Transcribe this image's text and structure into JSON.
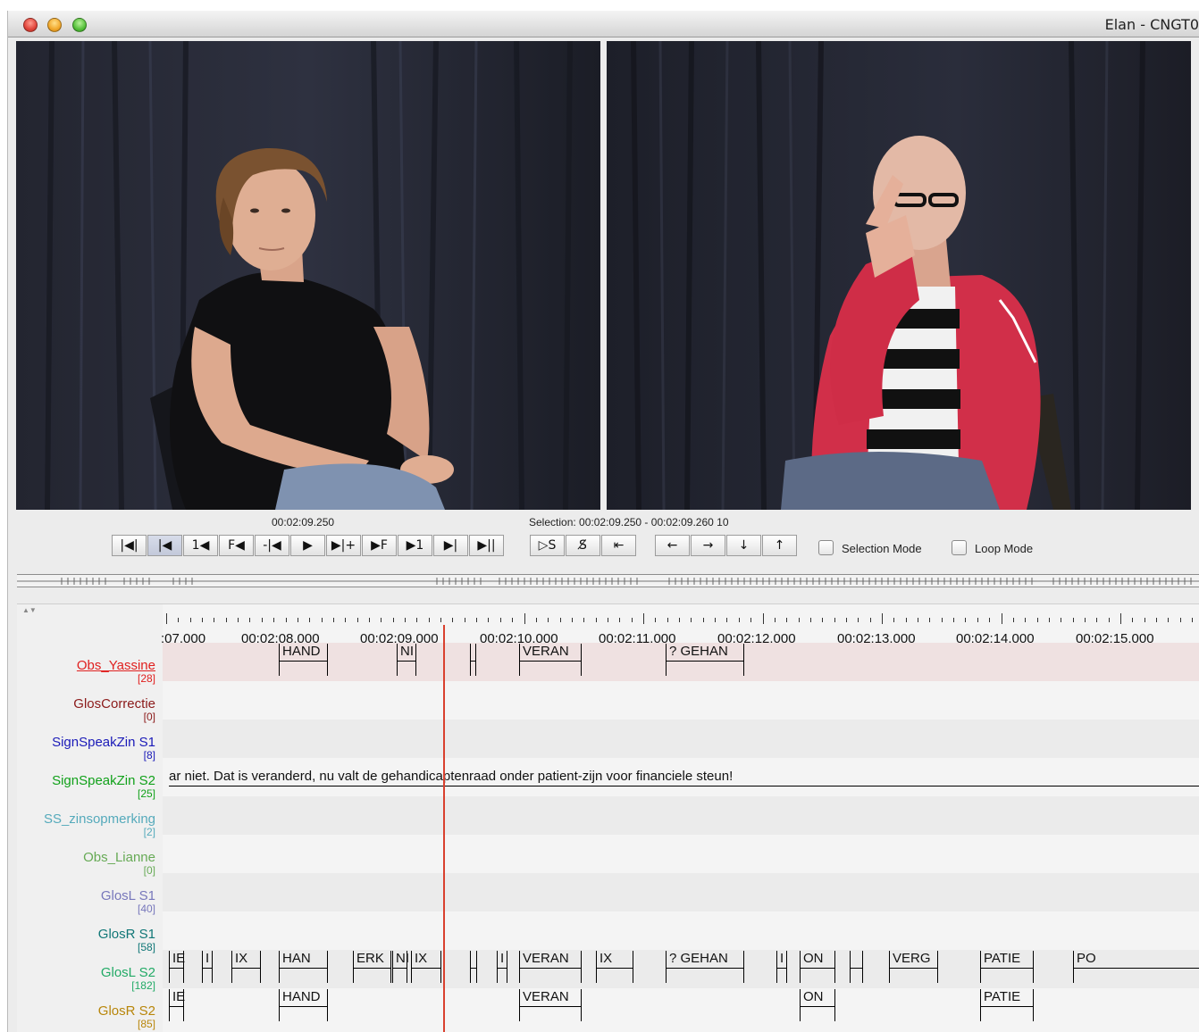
{
  "window": {
    "title": "Elan - CNGT0"
  },
  "player": {
    "current_time": "00:02:09.250",
    "selection": "Selection: 00:02:09.250 - 00:02:09.260  10",
    "buttons": [
      "|◀|",
      "|◀",
      "1◀",
      "F◀",
      "-|◀",
      "▶",
      "▶|+",
      "▶F",
      "▶1",
      "▶|",
      "▶||"
    ],
    "selection_buttons": [
      "▷S",
      "S̸",
      "⇤"
    ],
    "nav_buttons": [
      "←",
      "→",
      "↓",
      "↑"
    ],
    "selection_mode_label": "Selection Mode",
    "loop_mode_label": "Loop Mode"
  },
  "ruler": {
    "labels": [
      ":07.000",
      "00:02:08.000",
      "00:02:09.000",
      "00:02:10.000",
      "00:02:11.000",
      "00:02:12.000",
      "00:02:13.000",
      "00:02:14.000",
      "00:02:15.000"
    ]
  },
  "tiers": [
    {
      "name": "Obs_Yassine",
      "count": "[28]",
      "color": "#e0201f"
    },
    {
      "name": "GlosCorrectie",
      "count": "[0]",
      "color": "#8b1a1a"
    },
    {
      "name": "SignSpeakZin S1",
      "count": "[8]",
      "color": "#1a1ab8"
    },
    {
      "name": "SignSpeakZin S2",
      "count": "[25]",
      "color": "#11a11a"
    },
    {
      "name": "SS_zinsopmerking",
      "count": "[2]",
      "color": "#55aabb"
    },
    {
      "name": "Obs_Lianne",
      "count": "[0]",
      "color": "#66aa55"
    },
    {
      "name": "GlosL S1",
      "count": "[40]",
      "color": "#7777bb"
    },
    {
      "name": "GlosR S1",
      "count": "[58]",
      "color": "#117777"
    },
    {
      "name": "GlosL S2",
      "count": "[182]",
      "color": "#22aa66"
    },
    {
      "name": "GlosR S2",
      "count": "[85]",
      "color": "#b8860b"
    }
  ],
  "annotations": {
    "obs_yassine": [
      "HAND",
      "NI",
      "",
      "VERAN",
      "? GEHAN"
    ],
    "signspeakzin_s2": "ar niet. Dat is veranderd, nu valt de gehandicaptenraad onder patient-zijn voor financiele steun!",
    "glosl_s2": [
      "IE",
      "I",
      "IX",
      "HAN",
      "ERK",
      "NI",
      "IX",
      "",
      "I",
      "VERAN",
      "IX",
      "? GEHAN",
      "I",
      "ON",
      "",
      "VERG",
      "PATIE",
      "PO"
    ],
    "glosr_s2": [
      "IE",
      "HAND",
      "VERAN",
      "ON",
      "PATIE"
    ]
  }
}
